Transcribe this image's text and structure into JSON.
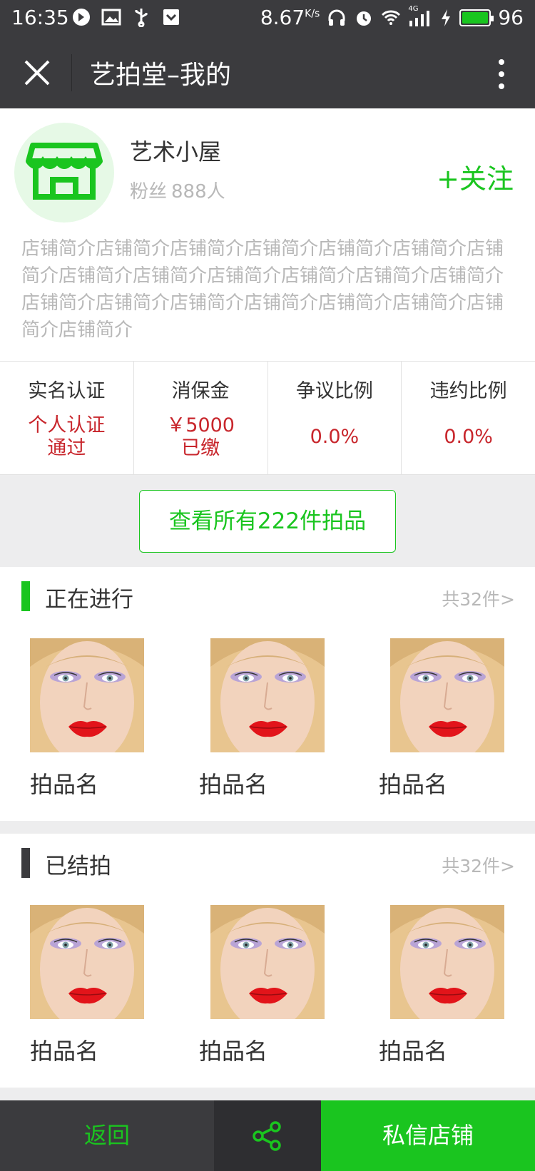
{
  "status_bar": {
    "time": "16:35",
    "speed": "8.67",
    "speed_unit": "K/s",
    "network": "4G",
    "battery": "96"
  },
  "title_bar": {
    "title": "艺拍堂–我的"
  },
  "profile": {
    "shop_name": "艺术小屋",
    "fans_label": "粉丝",
    "fans_count": "888人",
    "follow_label": "+关注",
    "intro": "店铺简介店铺简介店铺简介店铺简介店铺简介店铺简介店铺简介店铺简介店铺简介店铺简介店铺简介店铺简介店铺简介店铺简介店铺简介店铺简介店铺简介店铺简介店铺简介店铺简介店铺简介"
  },
  "stats": [
    {
      "label": "实名认证",
      "value_line1": "个人认证",
      "value_line2": "通过"
    },
    {
      "label": "消保金",
      "value_line1": "￥5000",
      "value_line2": "已缴"
    },
    {
      "label": "争议比例",
      "value_line1": "0.0%",
      "value_line2": ""
    },
    {
      "label": "违约比例",
      "value_line1": "0.0%",
      "value_line2": ""
    }
  ],
  "view_all_label": "查看所有222件拍品",
  "sections": [
    {
      "title": "正在进行",
      "more": "共32件>",
      "items": [
        {
          "name": "拍品名"
        },
        {
          "name": "拍品名"
        },
        {
          "name": "拍品名"
        }
      ]
    },
    {
      "title": "已结拍",
      "more": "共32件>",
      "items": [
        {
          "name": "拍品名"
        },
        {
          "name": "拍品名"
        },
        {
          "name": "拍品名"
        }
      ]
    }
  ],
  "bottom_bar": {
    "back_label": "返回",
    "share_icon": "share-icon",
    "message_label": "私信店铺"
  },
  "colors": {
    "accent_green": "#1ac51f",
    "dark_bar": "#3b3b3e",
    "stat_red": "#c8262c"
  }
}
